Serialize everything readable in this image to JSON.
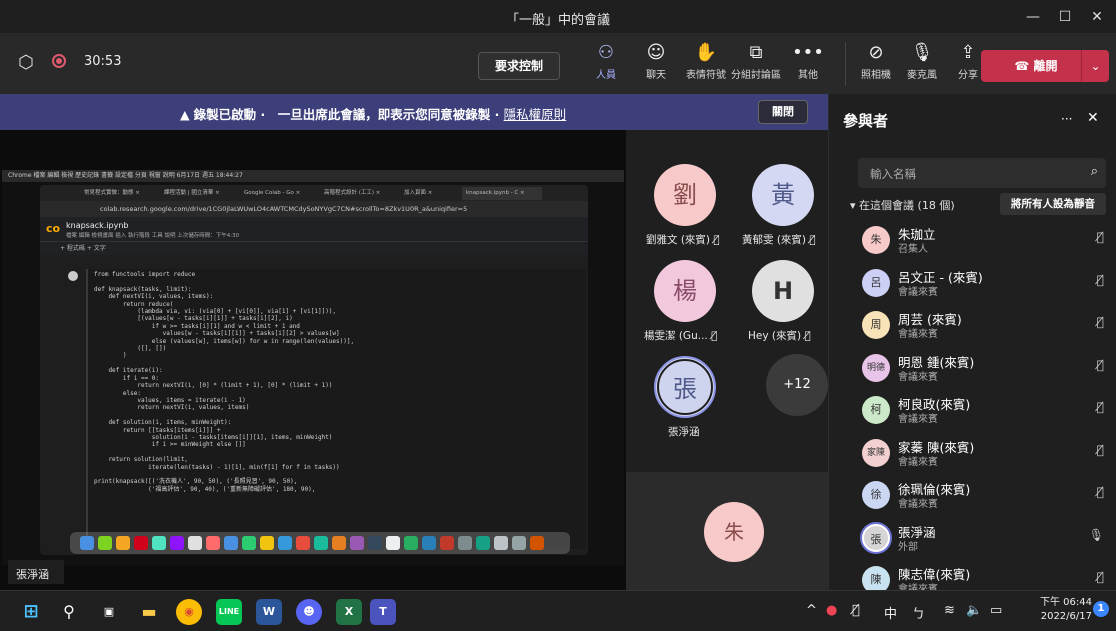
{
  "window": {
    "title": "「一般」中的會議",
    "minimize": "—",
    "maximize": "☐",
    "close": "✕"
  },
  "toolbar": {
    "timer": "30:53",
    "request_control": "要求控制",
    "people": "人員",
    "chat": "聊天",
    "reactions": "表情符號",
    "rooms": "分組討論區",
    "more": "其他",
    "camera": "照相機",
    "mic": "麥克風",
    "share": "分享",
    "leave": "離開"
  },
  "banner": {
    "icon": "▲",
    "text": "錄製已啟動 ·　一旦出席此會議，即表示您同意被錄製 · ",
    "link": "隱私權原則",
    "close": "關閉"
  },
  "screen_share": {
    "mac_menu": "Chrome  檔案  編輯  檢視  歷史記錄  書籤  設定檔  分頁  視窗  說明                    6月17日 週五 18:44:27",
    "tabs": [
      "常見程式實做：動態 ×",
      "課程活動 | 國立清華 ×",
      "Google Colab - Go ×",
      "高階程式設計 (工工) ×",
      "加入頁面 ×",
      "knapsack.ipynb - C ×"
    ],
    "url": "colab.research.google.com/drive/1CG0jlaLWUwLO4cAWTCMCdySoNYVgC7CN#scrollTo=8Zkv1U0R_a&uniqifier=5",
    "notebook_name": "knapsack.ipynb",
    "notebook_menu": "檔案  編輯  檢視畫面  插入  執行階段  工具  說明  上次儲存時間：下午4:30",
    "notebook_bar": "+ 程式碼   + 文字",
    "code": "from functools import reduce\n\ndef knapsack(tasks, limit):\n    def nextVI(i, values, items):\n        return reduce(\n            (lambda via, vi: (via[0] + [vi[0]], via[1] + [vi[1]])),\n            [(values[w - tasks[i][1]] + tasks[i][2], i)\n                if w >= tasks[i][1] and w < limit + 1 and\n                   values[w - tasks[i][1]] + tasks[i][2] > values[w]\n                else (values[w], items[w]) for w in range(len(values))],\n            ([], [])\n        )\n\n    def iterate(i):\n        if i == 0:\n            return nextVI(i, [0] * (limit + 1), [0] * (limit + 1))\n        else:\n            values, items = iterate(i - 1)\n            return nextVI(i, values, items)\n\n    def solution(i, items, minWeight):\n        return [[tasks[items[i]]] +\n                solution(i - tasks[items[i]][1], items, minWeight)\n                if i >= minWeight else []]\n\n    return solution(limit,\n               iterate(len(tasks) - 1)[1], min(f[1] for f in tasks))\n\nprint(knapsack([('洗衣機人', 90, 50), ('長照見習', 90, 50),\n               ('福高評估', 90, 40), ('重新無障礙評估', 180, 90),"
  },
  "stage_name": "張淨涵",
  "gallery": [
    {
      "initial": "劉",
      "name": "劉雅文 (來賓)"
    },
    {
      "initial": "黃",
      "name": "黃郁雯 (來賓)"
    },
    {
      "initial": "楊",
      "name": "楊雯潔 (Gu..."
    },
    {
      "initial": "H",
      "name": "Hey (來賓)"
    },
    {
      "initial": "張",
      "name": "張淨涵"
    },
    {
      "initial": "朱",
      "name": ""
    }
  ],
  "overflow_count": "+12",
  "panel": {
    "title": "參與者",
    "more": "···",
    "close": "✕",
    "search_placeholder": "輸入名稱",
    "section": "在這個會議 (18 個)",
    "mute_all": "將所有人設為靜音",
    "participants": [
      {
        "initial": "朱",
        "name": "朱珈立",
        "role": "召集人",
        "color": "#f7c9c9"
      },
      {
        "initial": "呂",
        "name": "呂文正 - (來賓)",
        "role": "會議來賓",
        "color": "#cbd0f4"
      },
      {
        "initial": "周",
        "name": "周芸 (來賓)",
        "role": "會議來賓",
        "color": "#f7e3b7"
      },
      {
        "initial": "明德",
        "name": "明恩 鍾(來賓)",
        "role": "會議來賓",
        "color": "#e7c4e8"
      },
      {
        "initial": "柯",
        "name": "柯良政(來賓)",
        "role": "會議來賓",
        "color": "#cbe8c9"
      },
      {
        "initial": "家陳",
        "name": "家蓁 陳(來賓)",
        "role": "會議來賓",
        "color": "#f2d0cf"
      },
      {
        "initial": "徐",
        "name": "徐珮倫(來賓)",
        "role": "會議來賓",
        "color": "#cbd6f2"
      },
      {
        "initial": "張",
        "name": "張淨涵",
        "role": "外部",
        "color": "#d5d5d5"
      },
      {
        "initial": "陳",
        "name": "陳志偉(來賓)",
        "role": "會議來賓",
        "color": "#c8e2f2"
      }
    ]
  },
  "taskbar": {
    "time": "下午 06:44",
    "date": "2022/6/17",
    "ime": "中",
    "ime2": "ㄅ",
    "notifications": "1"
  },
  "colors": {
    "accent": "#6264a7",
    "leave": "#c4314b",
    "banner": "#3d3f7a"
  }
}
